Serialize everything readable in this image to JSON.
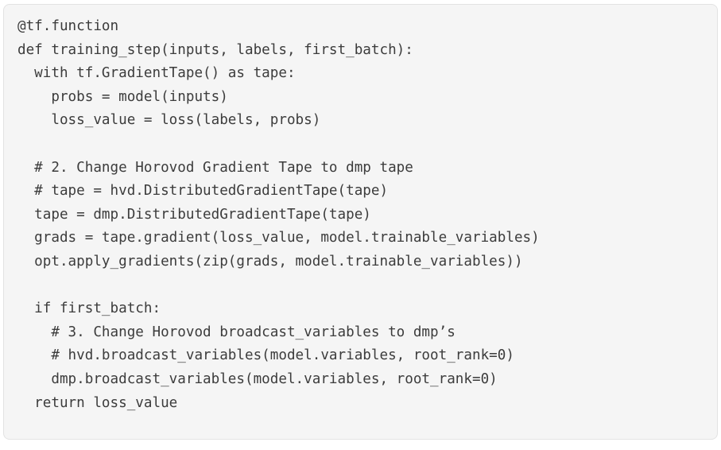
{
  "code_block": {
    "language": "python",
    "background_color": "#f5f5f5",
    "border_color": "#e3e3e3",
    "text_color": "#3c3c3c",
    "lines": [
      "@tf.function",
      "def training_step(inputs, labels, first_batch):",
      "  with tf.GradientTape() as tape:",
      "    probs = model(inputs)",
      "    loss_value = loss(labels, probs)",
      "",
      "  # 2. Change Horovod Gradient Tape to dmp tape",
      "  # tape = hvd.DistributedGradientTape(tape)",
      "  tape = dmp.DistributedGradientTape(tape)",
      "  grads = tape.gradient(loss_value, model.trainable_variables)",
      "  opt.apply_gradients(zip(grads, model.trainable_variables))",
      "",
      "  if first_batch:",
      "    # 3. Change Horovod broadcast_variables to dmp’s",
      "    # hvd.broadcast_variables(model.variables, root_rank=0)",
      "    dmp.broadcast_variables(model.variables, root_rank=0)",
      "  return loss_value"
    ]
  }
}
